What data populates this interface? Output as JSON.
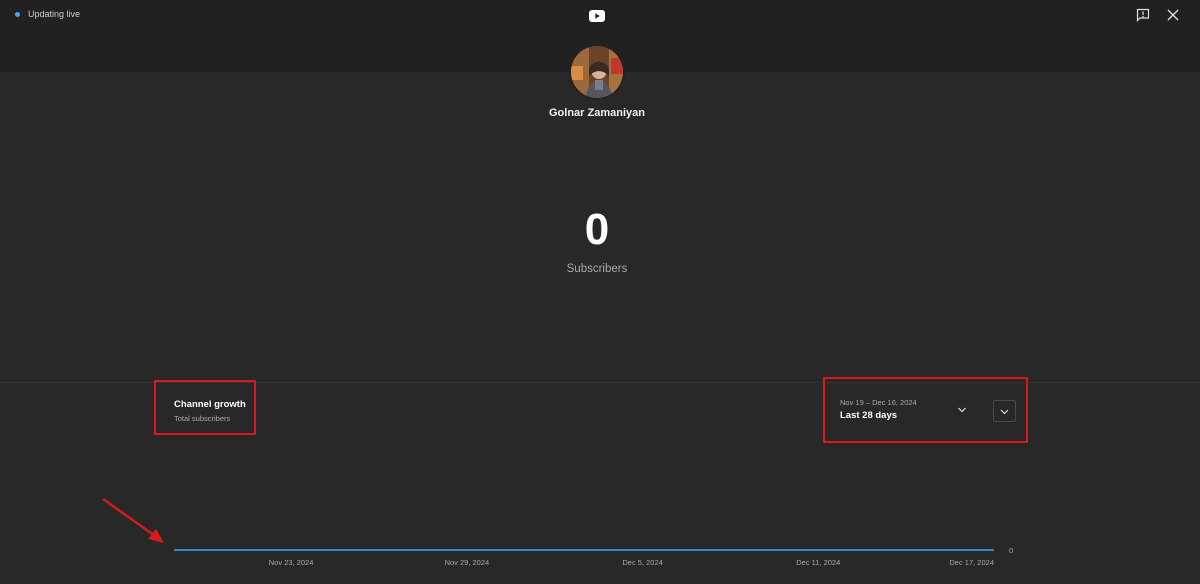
{
  "header": {
    "live_status": "Updating live",
    "logo": "youtube-logo-icon",
    "feedback_icon": "feedback-icon",
    "close_icon": "close-icon"
  },
  "channel": {
    "name": "Golnar Zamaniyan",
    "subscriber_count": "0",
    "subscriber_label": "Subscribers"
  },
  "growth": {
    "title": "Channel growth",
    "subtitle": "Total subscribers"
  },
  "date_range": {
    "dates": "Nov 19 – Dec 16, 2024",
    "label": "Last 28 days"
  },
  "colors": {
    "accent": "#3ea6ff",
    "highlight": "#d9191b"
  },
  "chart_data": {
    "type": "line",
    "x": [
      "Nov 19, 2024",
      "Nov 23, 2024",
      "Nov 29, 2024",
      "Dec 5, 2024",
      "Dec 11, 2024",
      "Dec 17, 2024"
    ],
    "x_tick_labels": [
      "Nov 23, 2024",
      "Nov 29, 2024",
      "Dec 5, 2024",
      "Dec 11, 2024",
      "Dec 17, 2024"
    ],
    "series": [
      {
        "values": [
          0,
          0,
          0,
          0,
          0,
          0
        ]
      }
    ],
    "y_tick_labels": [
      "0"
    ],
    "title": "",
    "xlabel": "",
    "ylabel": "",
    "grid": false
  }
}
